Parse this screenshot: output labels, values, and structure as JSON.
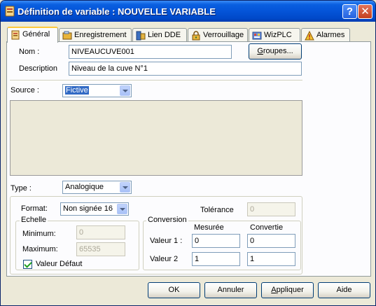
{
  "window": {
    "title": "Définition de variable : NOUVELLE VARIABLE",
    "help_glyph": "?",
    "close_glyph": "✕"
  },
  "tabs": [
    {
      "label": "Général",
      "icon": "general-icon"
    },
    {
      "label": "Enregistrement",
      "icon": "recording-icon"
    },
    {
      "label": "Lien DDE",
      "icon": "dde-link-icon"
    },
    {
      "label": "Verrouillage",
      "icon": "lock-icon"
    },
    {
      "label": "WizPLC",
      "icon": "wizplc-icon"
    },
    {
      "label": "Alarmes",
      "icon": "alarm-icon"
    }
  ],
  "general": {
    "name_label": "Nom :",
    "name_value": "NIVEAUCUVE001",
    "groups_button_prefix": "G",
    "groups_button_rest": "roupes...",
    "description_label": "Description",
    "description_value": "Niveau de la cuve N°1",
    "source_label": "Source :",
    "source_value": "Fictive",
    "type_label": "Type :",
    "type_value": "Analogique"
  },
  "format": {
    "format_label": "Format:",
    "format_value": "Non signée 16",
    "tolerance_label": "Tolérance",
    "tolerance_value": "0",
    "echelle_title": "Echelle",
    "minimum_label": "Minimum:",
    "minimum_value": "0",
    "maximum_label": "Maximum:",
    "maximum_value": "65535",
    "default_value_label": "Valeur Défaut",
    "default_value_checked": true
  },
  "conversion": {
    "title": "Conversion",
    "col_measured": "Mesurée",
    "col_converted": "Convertie",
    "row1_label": "Valeur 1 :",
    "row1_measured": "0",
    "row1_converted": "0",
    "row2_label": "Valeur 2",
    "row2_measured": "1",
    "row2_converted": "1"
  },
  "buttons": {
    "ok": "OK",
    "cancel": "Annuler",
    "apply_prefix": "A",
    "apply_rest": "ppliquer",
    "help": "Aide"
  },
  "colors": {
    "titlebar": "#0454d8",
    "dialog_bg": "#ece9d8",
    "active_tab_accent": "#ffc83c",
    "selection": "#316ac5"
  }
}
